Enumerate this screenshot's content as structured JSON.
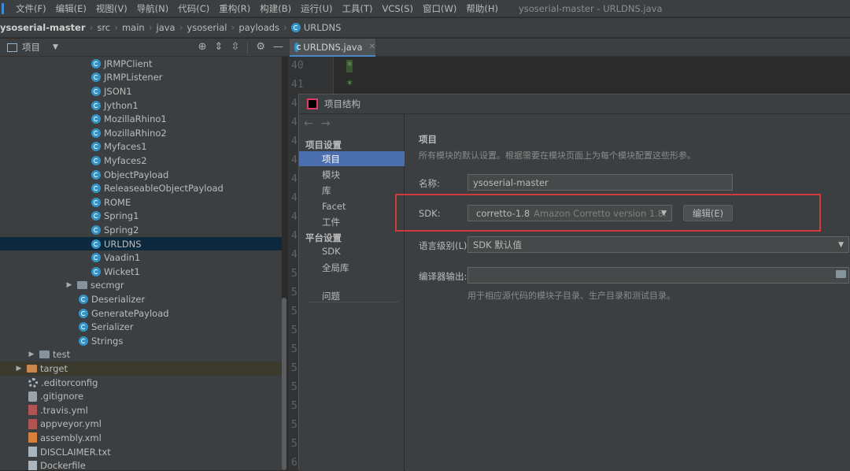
{
  "menubar": {
    "items": [
      "文件(F)",
      "编辑(E)",
      "视图(V)",
      "导航(N)",
      "代码(C)",
      "重构(R)",
      "构建(B)",
      "运行(U)",
      "工具(T)",
      "VCS(S)",
      "窗口(W)",
      "帮助(H)"
    ],
    "window_title": "ysoserial-master - URLDNS.java"
  },
  "breadcrumb": {
    "items": [
      "ysoserial-master",
      "src",
      "main",
      "java",
      "ysoserial",
      "payloads",
      "URLDNS"
    ]
  },
  "project_panel": {
    "title": "项目",
    "tree": [
      {
        "name": "JRMPClient",
        "icon": "class-icon"
      },
      {
        "name": "JRMPListener",
        "icon": "class-icon"
      },
      {
        "name": "JSON1",
        "icon": "class-icon"
      },
      {
        "name": "Jython1",
        "icon": "class-icon"
      },
      {
        "name": "MozillaRhino1",
        "icon": "class-icon"
      },
      {
        "name": "MozillaRhino2",
        "icon": "class-icon"
      },
      {
        "name": "Myfaces1",
        "icon": "class-icon"
      },
      {
        "name": "Myfaces2",
        "icon": "class-icon"
      },
      {
        "name": "ObjectPayload",
        "icon": "class-icon"
      },
      {
        "name": "ReleaseableObjectPayload",
        "icon": "class-icon"
      },
      {
        "name": "ROME",
        "icon": "class-icon"
      },
      {
        "name": "Spring1",
        "icon": "class-icon"
      },
      {
        "name": "Spring2",
        "icon": "class-icon"
      },
      {
        "name": "URLDNS",
        "icon": "class-icon",
        "selected": true
      },
      {
        "name": "Vaadin1",
        "icon": "class-icon"
      },
      {
        "name": "Wicket1",
        "icon": "class-icon"
      },
      {
        "name": "secmgr",
        "icon": "folder-icon"
      },
      {
        "name": "Deserializer",
        "icon": "class-icon"
      },
      {
        "name": "GeneratePayload",
        "icon": "class-icon"
      },
      {
        "name": "Serializer",
        "icon": "class-icon"
      },
      {
        "name": "Strings",
        "icon": "class-icon"
      },
      {
        "name": "test",
        "icon": "folder-icon"
      },
      {
        "name": "target",
        "icon": "folder-icon"
      },
      {
        "name": ".editorconfig",
        "icon": "gear-icon"
      },
      {
        "name": ".gitignore",
        "icon": "git-icon"
      },
      {
        "name": ".travis.yml",
        "icon": "yml-file-icon"
      },
      {
        "name": "appveyor.yml",
        "icon": "yml-file-icon"
      },
      {
        "name": "assembly.xml",
        "icon": "xml-file-icon"
      },
      {
        "name": "DISCLAIMER.txt",
        "icon": "text-file-icon"
      },
      {
        "name": "Dockerfile",
        "icon": "text-file-icon"
      }
    ]
  },
  "editor": {
    "tab_label": "URLDNS.java",
    "line_numbers": [
      "40",
      "41",
      "4",
      "4",
      "4",
      "4",
      "4",
      "4",
      "4",
      "4",
      "4",
      "5",
      "5",
      "5",
      "5",
      "5",
      "5",
      "5",
      "5",
      "5",
      "5",
      "6",
      "6",
      "6"
    ],
    "code_glyph": "*"
  },
  "dialog": {
    "title": "项目结构",
    "nav_back": "←",
    "nav_forward": "→",
    "sidebar": {
      "project_settings_header": "项目设置",
      "project_settings": [
        "项目",
        "模块",
        "库",
        "Facet",
        "工件"
      ],
      "platform_settings_header": "平台设置",
      "platform_settings": [
        "SDK",
        "全局库"
      ],
      "problems": "问题"
    },
    "main": {
      "heading": "项目",
      "description": "所有模块的默认设置。根据需要在模块页面上为每个模块配置这些形参。",
      "name_label": "名称:",
      "name_value": "ysoserial-master",
      "sdk_label": "SDK:",
      "sdk_value": "corretto-1.8",
      "sdk_detail": "Amazon Corretto version 1.8.",
      "edit_button": "编辑(E)",
      "language_level_label": "语言级别(L):",
      "language_level_value": "SDK 默认值",
      "compiler_output_label": "编译器输出:",
      "compiler_output_value": "",
      "compiler_output_hint": "用于相应源代码的模块子目录、生产目录和测试目录。"
    }
  },
  "colors": {
    "highlight_box": "#d23b3b",
    "selection": "#4b6eaf",
    "tree_selection": "#0d293e"
  }
}
